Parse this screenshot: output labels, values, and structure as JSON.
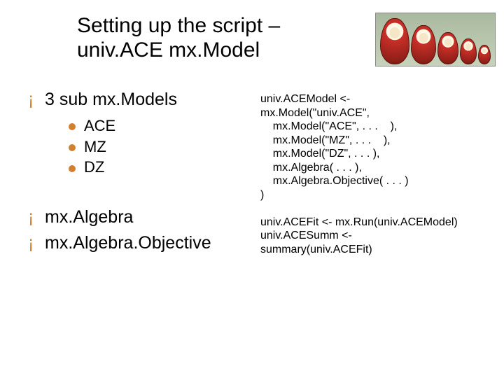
{
  "title_line1": "Setting up the script –",
  "title_line2": "univ.ACE mx.Model",
  "decor_alt": "matryoshka-dolls",
  "bullets": {
    "b1": "3 sub mx.Models",
    "b1_items": {
      "i1": "ACE",
      "i2": "MZ",
      "i3": "DZ"
    },
    "b2": "mx.Algebra",
    "b3": "mx.Algebra.Objective"
  },
  "code_lines": {
    "l1": "univ.ACEModel <-",
    "l2": "mx.Model(\"univ.ACE\",",
    "l3": "    mx.Model(\"ACE\", . . .    ),",
    "l4": "    mx.Model(\"MZ\", . . .    ),",
    "l5": "    mx.Model(\"DZ\", . . . ),",
    "l6": "    mx.Algebra( . . . ),",
    "l7": "    mx.Algebra.Objective( . . . )",
    "l8": ")",
    "l9": "",
    "l10": "univ.ACEFit <- mx.Run(univ.ACEModel)",
    "l11": "univ.ACESumm <-",
    "l12": "summary(univ.ACEFit)"
  }
}
